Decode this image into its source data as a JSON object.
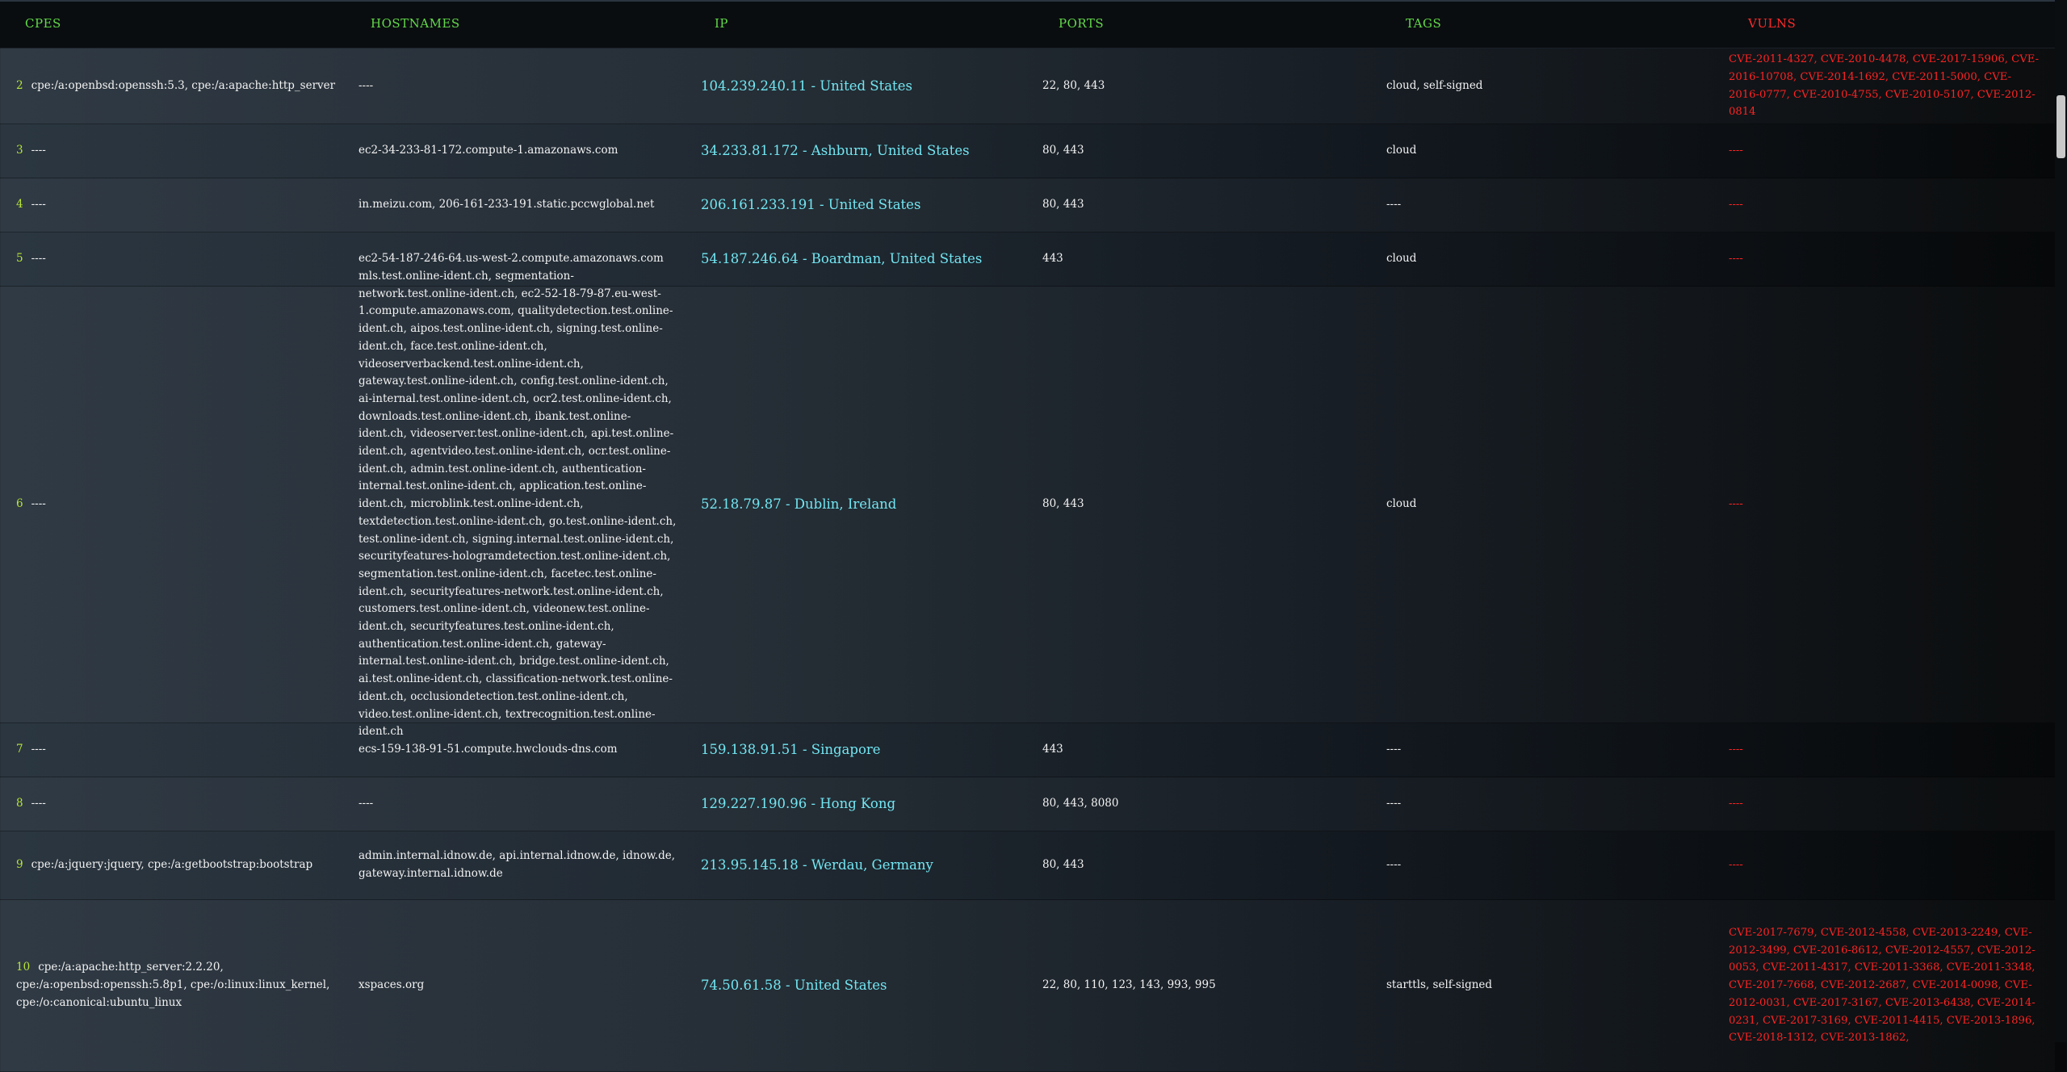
{
  "headers": {
    "cpes": "CPES",
    "hostnames": "HOSTNAMES",
    "ip": "IP",
    "ports": "PORTS",
    "tags": "TAGS",
    "vulns": "VULNS"
  },
  "rows": [
    {
      "num": "2",
      "cpes": "cpe:/a:openbsd:openssh:5.3, cpe:/a:apache:http_server",
      "hostnames": "----",
      "ip": "104.239.240.11 - United States",
      "ports": "22, 80, 443",
      "tags": "cloud, self-signed",
      "vulns": "CVE-2011-4327, CVE-2010-4478, CVE-2017-15906, CVE-2016-10708, CVE-2014-1692, CVE-2011-5000, CVE-2016-0777, CVE-2010-4755, CVE-2010-5107, CVE-2012-0814"
    },
    {
      "num": "3",
      "cpes": "----",
      "hostnames": "ec2-34-233-81-172.compute-1.amazonaws.com",
      "ip": "34.233.81.172 - Ashburn, United States",
      "ports": "80, 443",
      "tags": "cloud",
      "vulns": "----"
    },
    {
      "num": "4",
      "cpes": "----",
      "hostnames": "in.meizu.com, 206-161-233-191.static.pccwglobal.net",
      "ip": "206.161.233.191 - United States",
      "ports": "80, 443",
      "tags": "----",
      "vulns": "----"
    },
    {
      "num": "5",
      "cpes": "----",
      "hostnames": "ec2-54-187-246-64.us-west-2.compute.amazonaws.com",
      "ip": "54.187.246.64 - Boardman, United States",
      "ports": "443",
      "tags": "cloud",
      "vulns": "----"
    },
    {
      "num": "6",
      "cpes": "----",
      "hostnames": "mls.test.online-ident.ch, segmentation-network.test.online-ident.ch, ec2-52-18-79-87.eu-west-1.compute.amazonaws.com, qualitydetection.test.online-ident.ch, aipos.test.online-ident.ch, signing.test.online-ident.ch, face.test.online-ident.ch, videoserverbackend.test.online-ident.ch, gateway.test.online-ident.ch, config.test.online-ident.ch, ai-internal.test.online-ident.ch, ocr2.test.online-ident.ch, downloads.test.online-ident.ch, ibank.test.online-ident.ch, videoserver.test.online-ident.ch, api.test.online-ident.ch, agentvideo.test.online-ident.ch, ocr.test.online-ident.ch, admin.test.online-ident.ch, authentication-internal.test.online-ident.ch, application.test.online-ident.ch, microblink.test.online-ident.ch, textdetection.test.online-ident.ch, go.test.online-ident.ch, test.online-ident.ch, signing.internal.test.online-ident.ch, securityfeatures-hologramdetection.test.online-ident.ch, segmentation.test.online-ident.ch, facetec.test.online-ident.ch, securityfeatures-network.test.online-ident.ch, customers.test.online-ident.ch, videonew.test.online-ident.ch, securityfeatures.test.online-ident.ch, authentication.test.online-ident.ch, gateway-internal.test.online-ident.ch, bridge.test.online-ident.ch, ai.test.online-ident.ch, classification-network.test.online-ident.ch, occlusiondetection.test.online-ident.ch, video.test.online-ident.ch, textrecognition.test.online-ident.ch",
      "ip": "52.18.79.87 - Dublin, Ireland",
      "ports": "80, 443",
      "tags": "cloud",
      "vulns": "----"
    },
    {
      "num": "7",
      "cpes": "----",
      "hostnames": "ecs-159-138-91-51.compute.hwclouds-dns.com",
      "ip": "159.138.91.51 - Singapore",
      "ports": "443",
      "tags": "----",
      "vulns": "----"
    },
    {
      "num": "8",
      "cpes": "----",
      "hostnames": "----",
      "ip": "129.227.190.96 - Hong Kong",
      "ports": "80, 443, 8080",
      "tags": "----",
      "vulns": "----"
    },
    {
      "num": "9",
      "cpes": "cpe:/a:jquery:jquery, cpe:/a:getbootstrap:bootstrap",
      "hostnames": "admin.internal.idnow.de, api.internal.idnow.de, idnow.de, gateway.internal.idnow.de",
      "ip": "213.95.145.18 - Werdau, Germany",
      "ports": "80, 443",
      "tags": "----",
      "vulns": "----"
    },
    {
      "num": "10",
      "cpes": "cpe:/a:apache:http_server:2.2.20, cpe:/a:openbsd:openssh:5.8p1, cpe:/o:linux:linux_kernel, cpe:/o:canonical:ubuntu_linux",
      "hostnames": "xspaces.org",
      "ip": "74.50.61.58 - United States",
      "ports": "22, 80, 110, 123, 143, 993, 995",
      "tags": "starttls, self-signed",
      "vulns": "CVE-2017-7679, CVE-2012-4558, CVE-2013-2249, CVE-2012-3499, CVE-2016-8612, CVE-2012-4557, CVE-2012-0053, CVE-2011-4317, CVE-2011-3368, CVE-2011-3348, CVE-2017-7668, CVE-2012-2687, CVE-2014-0098, CVE-2012-0031, CVE-2017-3167, CVE-2013-6438, CVE-2014-0231, CVE-2017-3169, CVE-2011-4415, CVE-2013-1896, CVE-2018-1312, CVE-2013-1862,"
    }
  ],
  "colors": {
    "header_text": "#62d94a",
    "vulns_header": "#ff2a2a",
    "row_number": "#b8e636",
    "ip_text": "#72e6f2",
    "vuln_text": "#ff2323",
    "body_text": "#f2f2f2"
  }
}
